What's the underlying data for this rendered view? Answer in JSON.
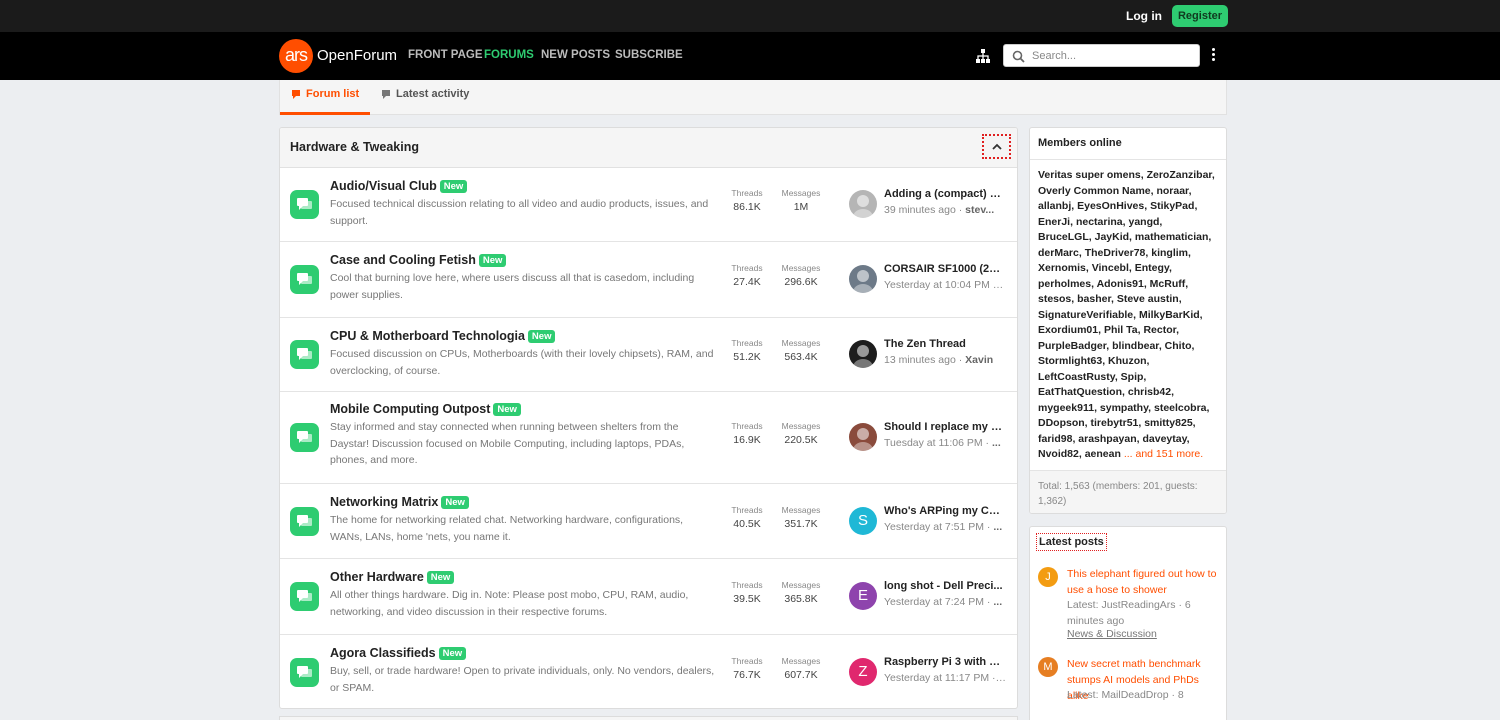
{
  "header": {
    "login_label": "Log in",
    "register_label": "Register"
  },
  "nav": {
    "logo_mark": "ars",
    "logo_text": "OpenForum",
    "links": [
      "FRONT PAGE",
      "FORUMS",
      "NEW POSTS",
      "SUBSCRIBE"
    ],
    "active_link": "FORUMS",
    "search_placeholder": "Search..."
  },
  "tabs": [
    {
      "label": "Forum list",
      "active": true
    },
    {
      "label": "Latest activity",
      "active": false
    }
  ],
  "category": {
    "title": "Hardware & Tweaking",
    "stat_labels": {
      "threads": "Threads",
      "messages": "Messages"
    },
    "nodes": [
      {
        "title": "Audio/Visual Club",
        "badge": "New",
        "desc": "Focused technical discussion relating to all video and audio products, issues, and support.",
        "threads": "86.1K",
        "messages": "1M",
        "last_title": "Adding a (compact) s...",
        "last_time": "39 minutes ago",
        "last_user": "stev...",
        "avatar_letter": "",
        "avatar_color": "#b5b5b5"
      },
      {
        "title": "Case and Cooling Fetish",
        "badge": "New",
        "desc": "Cool that burning love here, where users discuss all that is casedom, including power supplies.",
        "threads": "27.4K",
        "messages": "296.6K",
        "last_title": "CORSAIR SF1000 (20...",
        "last_time": "Yesterday at 10:04 PM",
        "last_user": "...",
        "avatar_letter": "",
        "avatar_color": "#6d7a88"
      },
      {
        "title": "CPU & Motherboard Technologia",
        "badge": "New",
        "desc": "Focused discussion on CPUs, Motherboards (with their lovely chipsets), RAM, and overclocking, of course.",
        "threads": "51.2K",
        "messages": "563.4K",
        "last_title": "The Zen Thread",
        "last_time": "13 minutes ago",
        "last_user": "Xavin",
        "avatar_letter": "",
        "avatar_color": "#1d1d1d"
      },
      {
        "title": "Mobile Computing Outpost",
        "badge": "New",
        "desc": "Stay informed and stay connected when running between shelters from the Daystar! Discussion focused on Mobile Computing, including laptops, PDAs, phones, and more.",
        "threads": "16.9K",
        "messages": "220.5K",
        "last_title": "Should I replace my G...",
        "last_time": "Tuesday at 11:06 PM",
        "last_user": "...",
        "avatar_letter": "",
        "avatar_color": "#8a4b3c"
      },
      {
        "title": "Networking Matrix",
        "badge": "New",
        "desc": "The home for networking related chat. Networking hardware, configurations, WANs, LANs, home 'nets, you name it.",
        "threads": "40.5K",
        "messages": "351.7K",
        "last_title": "Who's ARPing my Ca...",
        "last_time": "Yesterday at 7:51 PM",
        "last_user": "...",
        "avatar_letter": "S",
        "avatar_color": "#1fb8d6"
      },
      {
        "title": "Other Hardware",
        "badge": "New",
        "desc": "All other things hardware. Dig in. Note: Please post mobo, CPU, RAM, audio, networking, and video discussion in their respective forums.",
        "threads": "39.5K",
        "messages": "365.8K",
        "last_title": "long shot - Dell Preci...",
        "last_time": "Yesterday at 7:24 PM",
        "last_user": "...",
        "avatar_letter": "E",
        "avatar_color": "#8e44ad"
      },
      {
        "title": "Agora Classifieds",
        "badge": "New",
        "desc": "Buy, sell, or trade hardware! Open to private individuals, only. No vendors, dealers, or SPAM.",
        "threads": "76.7K",
        "messages": "607.7K",
        "last_title": "Raspberry Pi 3 with c...",
        "last_time": "Yesterday at 11:17 PM",
        "last_user": "...",
        "avatar_letter": "Z",
        "avatar_color": "#e0286e"
      }
    ]
  },
  "members_online": {
    "title": "Members online",
    "names": [
      "Veritas super omens",
      "ZeroZanzibar",
      "Overly Common Name",
      "noraar",
      "allanbj",
      "EyesOnHives",
      "StikyPad",
      "EnerJi",
      "nectarina",
      "yangd",
      "BruceLGL",
      "JayKid",
      "mathematician",
      "derMarc",
      "TheDriver78",
      "kinglim",
      "Xernomis",
      "Vincebl",
      "Entegy",
      "perholmes",
      "Adonis91",
      "McRuff",
      "stesos",
      "basher",
      "Steve austin",
      "SignatureVerifiable",
      "MilkyBarKid",
      "Exordium01",
      "Phil Ta",
      "Rector",
      "PurpleBadger",
      "blindbear",
      "Chito",
      "Stormlight63",
      "Khuzon",
      "LeftCoastRusty",
      "Spip",
      "EatThatQuestion",
      "chrisb42",
      "mygeek911",
      "sympathy",
      "steelcobra",
      "DDopson",
      "tirebytr51",
      "smitty825",
      "farid98",
      "arashpayan",
      "daveytay",
      "Nvoid82",
      "aenean"
    ],
    "more": "... and 151 more.",
    "total": "Total: 1,563 (members: 201, guests: 1,362)"
  },
  "latest_posts": {
    "title": "Latest posts",
    "items": [
      {
        "avatar_letter": "J",
        "avatar_color": "#f39c12",
        "title": "This elephant figured out how to use a hose to shower",
        "meta": "Latest: JustReadingArs · 6 minutes ago",
        "forum": "News & Discussion"
      },
      {
        "avatar_letter": "M",
        "avatar_color": "#e67e22",
        "title": "New secret math benchmark stumps AI models and PhDs alike",
        "meta": "Latest: MailDeadDrop · 8",
        "forum": ""
      }
    ]
  }
}
